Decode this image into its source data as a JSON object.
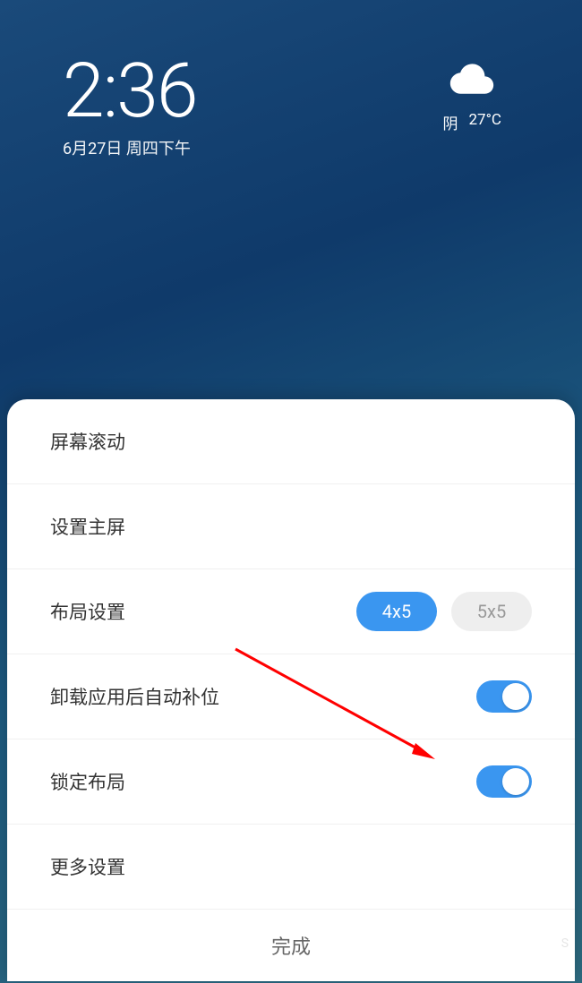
{
  "clock": {
    "time": "2:36",
    "date": "6月27日 周四下午"
  },
  "weather": {
    "condition": "阴",
    "temperature": "27°C"
  },
  "settings": {
    "screen_scroll": "屏幕滚动",
    "set_home": "设置主屏",
    "layout_settings": "布局设置",
    "layout_options": {
      "option1": "4x5",
      "option2": "5x5",
      "selected": "4x5"
    },
    "auto_fill": {
      "label": "卸载应用后自动补位",
      "enabled": true
    },
    "lock_layout": {
      "label": "锁定布局",
      "enabled": true
    },
    "more_settings": "更多设置",
    "done": "完成"
  }
}
